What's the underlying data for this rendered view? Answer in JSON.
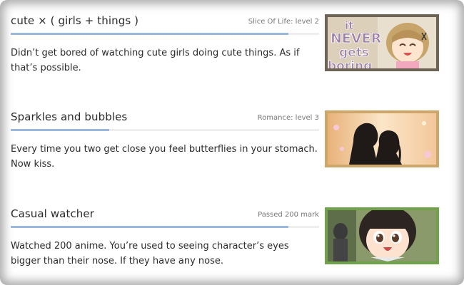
{
  "achievements": [
    {
      "title": "cute × ( girls + things )",
      "meta": "Slice Of Life: level 2",
      "description": "Didn’t get bored of watching cute girls doing cute things. As if that’s possible.",
      "progress": 0.9,
      "image_text": [
        "it",
        "NEVER",
        "gets",
        "boring"
      ]
    },
    {
      "title": "Sparkles and bubbles",
      "meta": "Romance: level 3",
      "description": "Every time you two get close you feel butterflies in your stomach. Now kiss.",
      "progress": 0.32,
      "image_text": []
    },
    {
      "title": "Casual watcher",
      "meta": "Passed 200 mark",
      "description": "Watched 200 anime. You’re used to seeing character’s eyes bigger than their nose. If they have any nose.",
      "progress": 0.9,
      "image_text": []
    }
  ],
  "colors": {
    "progress_fill": "#9ab8dc",
    "progress_track": "#eeeeee",
    "border_level2": "#6d6455",
    "border_level3": "#cda66a",
    "border_passed": "#6fa24a"
  }
}
